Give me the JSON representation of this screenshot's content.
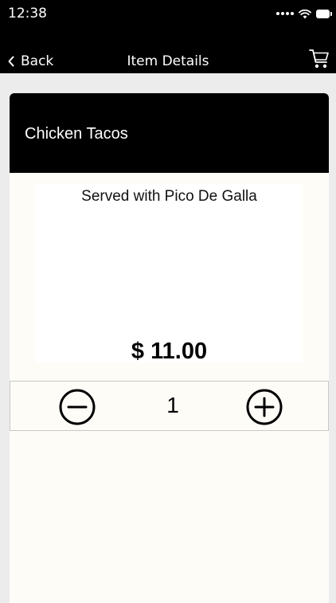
{
  "status_bar": {
    "time": "12:38"
  },
  "nav": {
    "back_label": "Back",
    "title": "Item Details",
    "back_icon": "chevron-left-icon",
    "cart_icon": "cart-icon"
  },
  "item": {
    "name": "Chicken Tacos",
    "description": "Served with Pico De Galla",
    "price": "$ 11.00"
  },
  "quantity": {
    "value": "1",
    "minus_icon": "minus-circle-icon",
    "plus_icon": "plus-circle-icon"
  },
  "colors": {
    "header_bg": "#000000",
    "card_bg": "#fdfcf7",
    "page_bg": "#ececec"
  }
}
